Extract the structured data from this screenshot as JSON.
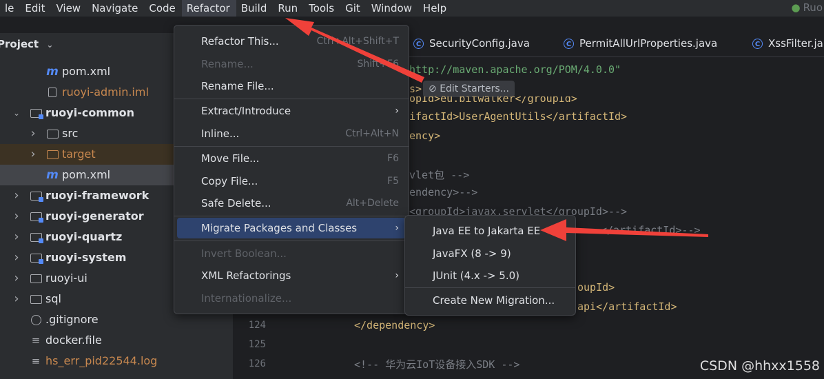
{
  "menubar": {
    "items": [
      "le",
      "Edit",
      "View",
      "Navigate",
      "Code",
      "Refactor",
      "Build",
      "Run",
      "Tools",
      "Git",
      "Window",
      "Help"
    ],
    "right_label": "Ruo"
  },
  "project": {
    "header": "Project",
    "rows": [
      {
        "label": "pom.xml",
        "indent": 66,
        "icon": "maven-icon",
        "arrow": ""
      },
      {
        "label": "ruoyi-admin.iml",
        "indent": 66,
        "icon": "iml-file-icon",
        "arrow": "",
        "orange": true
      },
      {
        "label": "ruoyi-common",
        "indent": 42,
        "icon": "module-folder-icon",
        "arrow": "v",
        "bold": true
      },
      {
        "label": "src",
        "indent": 66,
        "icon": "folder-icon",
        "arrow": ">"
      },
      {
        "label": "target",
        "indent": 66,
        "icon": "folder-orange-icon",
        "arrow": ">",
        "orange": true,
        "target": true
      },
      {
        "label": "pom.xml",
        "indent": 66,
        "icon": "maven-icon",
        "arrow": "",
        "selected": true
      },
      {
        "label": "ruoyi-framework",
        "indent": 42,
        "icon": "module-folder-icon",
        "arrow": ">",
        "bold": true
      },
      {
        "label": "ruoyi-generator",
        "indent": 42,
        "icon": "module-folder-icon",
        "arrow": ">",
        "bold": true
      },
      {
        "label": "ruoyi-quartz",
        "indent": 42,
        "icon": "module-folder-icon",
        "arrow": ">",
        "bold": true
      },
      {
        "label": "ruoyi-system",
        "indent": 42,
        "icon": "module-folder-icon",
        "arrow": ">",
        "bold": true
      },
      {
        "label": "ruoyi-ui",
        "indent": 42,
        "icon": "folder-icon",
        "arrow": ">"
      },
      {
        "label": "sql",
        "indent": 42,
        "icon": "folder-icon",
        "arrow": ">"
      },
      {
        "label": ".gitignore",
        "indent": 42,
        "icon": "gitignore-icon",
        "arrow": ""
      },
      {
        "label": "docker.file",
        "indent": 42,
        "icon": "text-file-icon",
        "arrow": ""
      },
      {
        "label": "hs_err_pid22544.log",
        "indent": 42,
        "icon": "log-file-icon",
        "arrow": "",
        "orange": true
      }
    ]
  },
  "tabs": [
    {
      "label": "SecurityConfig.java"
    },
    {
      "label": "PermitAllUrlProperties.java"
    },
    {
      "label": "XssFilter.ja"
    }
  ],
  "editor": {
    "hint": "Edit Starters...",
    "lines": [
      {
        "text": "http://maven.apache.org/POM/4.0.0\"",
        "cls": "str"
      },
      {
        "text": "s>",
        "cls": "tag"
      },
      {
        "text": "opId>eu.bitwalker</groupId>",
        "cls": "tag"
      },
      {
        "text": "ifactId>UserAgentUtils</artifactId>",
        "cls": "tag"
      },
      {
        "text": "ency>",
        "cls": "tag"
      },
      {
        "text": "vlet包 -->",
        "cls": "com"
      },
      {
        "text": "endency>-->",
        "cls": "com"
      },
      {
        "text": "<groupId>javax.servlet</groupId>-->",
        "cls": "com"
      },
      {
        "text": "</artifactId>-->",
        "cls": "com"
      },
      {
        "text": "oupId>",
        "cls": "tag"
      },
      {
        "text": "api</artifactId>",
        "cls": "tag"
      },
      {
        "text": "</dependency>",
        "cls": "tag"
      },
      {
        "text": "<!-- 华为云IoT设备接入SDK -->",
        "cls": "com"
      }
    ],
    "gutter": [
      "124",
      "125",
      "126"
    ]
  },
  "refactor_menu": {
    "items": [
      {
        "label": "Refactor This...",
        "shortcut": "Ctrl+Alt+Shift+T"
      },
      {
        "label": "Rename...",
        "shortcut": "Shift+F6",
        "disabled": true
      },
      {
        "label": "Rename File...",
        "shortcut": ""
      },
      {
        "label": "Extract/Introduce",
        "shortcut": "",
        "submenu": true
      },
      {
        "label": "Inline...",
        "shortcut": "Ctrl+Alt+N"
      },
      {
        "label": "Move File...",
        "shortcut": "F6"
      },
      {
        "label": "Copy File...",
        "shortcut": "F5"
      },
      {
        "label": "Safe Delete...",
        "shortcut": "Alt+Delete"
      },
      {
        "label": "Migrate Packages and Classes",
        "shortcut": "",
        "submenu": true,
        "highlighted": true
      },
      {
        "label": "Invert Boolean...",
        "shortcut": "",
        "disabled": true
      },
      {
        "label": "XML Refactorings",
        "shortcut": "",
        "submenu": true
      },
      {
        "label": "Internationalize...",
        "shortcut": "",
        "disabled": true
      }
    ]
  },
  "migrate_submenu": {
    "items": [
      {
        "label": "Java EE to Jakarta EE"
      },
      {
        "label": "JavaFX (8 -> 9)"
      },
      {
        "label": "JUnit (4.x -> 5.0)"
      },
      {
        "label": "Create New Migration..."
      }
    ]
  },
  "watermark": "CSDN @hhxx1558",
  "colors": {
    "accent": "#2e436e",
    "arrow": "#f0413a",
    "folder": "#a7a9ae"
  }
}
